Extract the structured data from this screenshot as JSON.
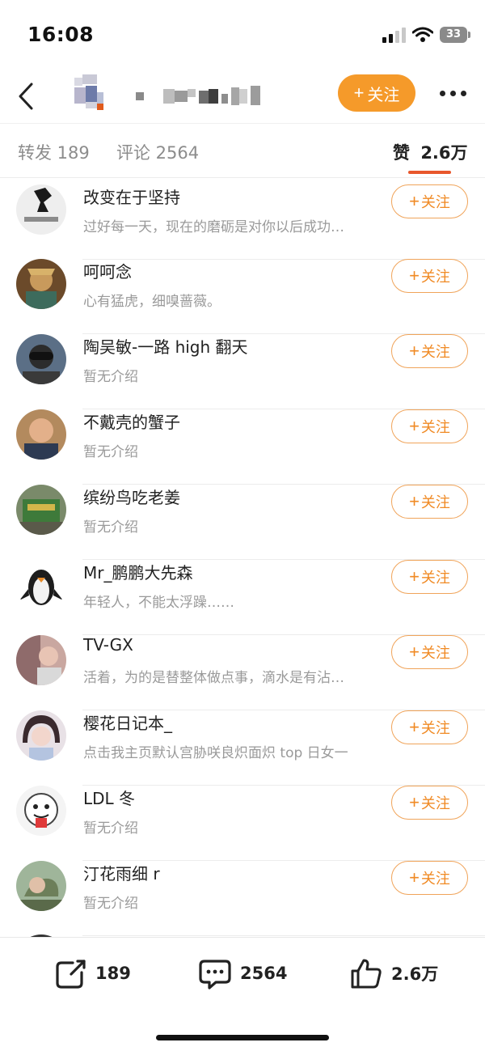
{
  "status_bar": {
    "time": "16:08",
    "battery": "33",
    "icons": [
      "signal-icon",
      "wifi-icon",
      "battery-icon"
    ]
  },
  "header": {
    "back_icon": "chevron-left-icon",
    "follow_label": "关注",
    "more_icon": "more-dots-icon"
  },
  "tabs": {
    "repost": "转发 189",
    "comment": "评论 2564",
    "like_label": "赞",
    "like_count": "2.6万",
    "active_color": "#e8572c"
  },
  "users": [
    {
      "name": "改变在于坚持",
      "bio": "过好每一天，现在的磨砺是对你以后成功…",
      "follow": "关注"
    },
    {
      "name": "呵呵念",
      "bio": "心有猛虎，细嗅蔷薇。",
      "follow": "关注"
    },
    {
      "name": "陶吴敏-一路 high 翻天",
      "bio": "暂无介绍",
      "follow": "关注"
    },
    {
      "name": "不戴壳的蟹子",
      "bio": "暂无介绍",
      "follow": "关注"
    },
    {
      "name": "缤纷鸟吃老姜",
      "bio": "暂无介绍",
      "follow": "关注"
    },
    {
      "name": "Mr_鹏鹏大先森",
      "bio": "年轻人，不能太浮躁……",
      "follow": "关注"
    },
    {
      "name": "TV-GX",
      "bio": "活着，为的是替整体做点事，滴水是有沾…",
      "follow": "关注"
    },
    {
      "name": "樱花日记本_",
      "bio": "点击我主页默认宫胁咲良炽面炽 top 日女一",
      "follow": "关注"
    },
    {
      "name": "LDL 冬",
      "bio": "暂无介绍",
      "follow": "关注"
    },
    {
      "name": "汀花雨细 r",
      "bio": "暂无介绍",
      "follow": "关注"
    }
  ],
  "bottom_bar": {
    "repost_count": "189",
    "comment_count": "2564",
    "like_count": "2.6万"
  },
  "colors": {
    "accent_orange": "#f59a2a",
    "follow_outline": "#f0a45a",
    "follow_text": "#f08a24"
  }
}
